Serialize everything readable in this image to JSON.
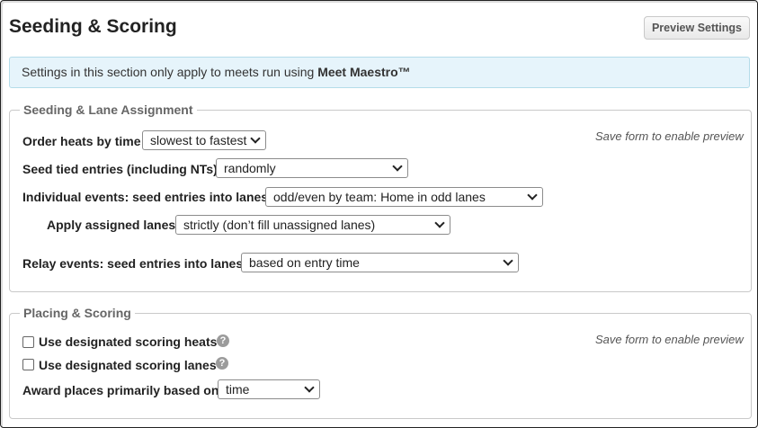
{
  "header": {
    "title": "Seeding & Scoring",
    "preview_button": "Preview Settings"
  },
  "banner": {
    "text": "Settings in this section only apply to meets run using ",
    "product": "Meet Maestro™"
  },
  "seeding": {
    "legend": "Seeding & Lane Assignment",
    "preview_note": "Save form to enable preview",
    "order_heats": {
      "label": "Order heats by time",
      "value": "slowest to fastest"
    },
    "tied_entries": {
      "label": "Seed tied entries (including NTs)",
      "value": "randomly"
    },
    "individual_lanes": {
      "label": "Individual events: seed entries into lanes",
      "value": "odd/even by team: Home in odd lanes"
    },
    "apply_lanes": {
      "label": "Apply assigned lanes",
      "value": "strictly (don’t fill unassigned lanes)"
    },
    "relay_lanes": {
      "label": "Relay events: seed entries into lanes",
      "value": "based on entry time"
    }
  },
  "placing": {
    "legend": "Placing & Scoring",
    "preview_note": "Save form to enable preview",
    "scoring_heats": {
      "label": "Use designated scoring heats",
      "checked": false
    },
    "scoring_lanes": {
      "label": "Use designated scoring lanes",
      "checked": false
    },
    "award_places": {
      "label": "Award places primarily based on",
      "value": "time"
    },
    "help_glyph": "?"
  }
}
